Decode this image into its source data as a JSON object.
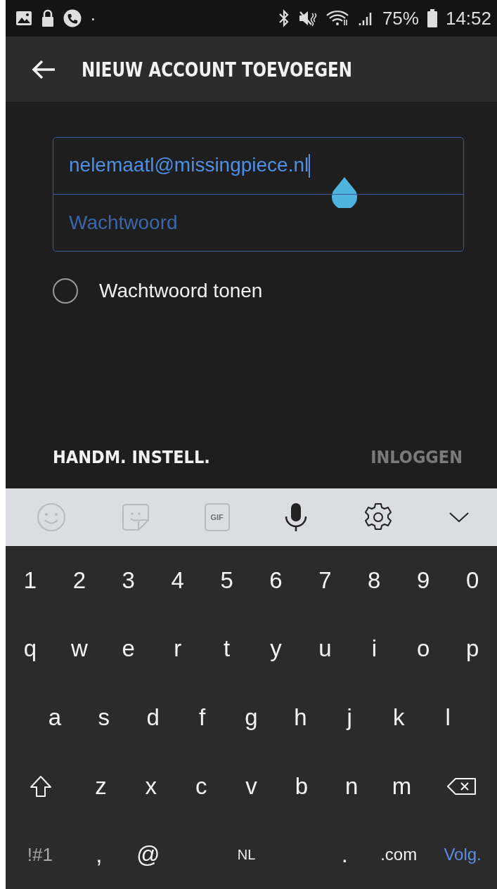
{
  "status_bar": {
    "notification_dot": "·",
    "battery": "75%",
    "time": "14:52"
  },
  "app_bar": {
    "title": "NIEUW ACCOUNT TOEVOEGEN"
  },
  "form": {
    "email": {
      "value": "nelemaatl@missingpiece.nl"
    },
    "password": {
      "placeholder": "Wachtwoord"
    },
    "show_password": {
      "label": "Wachtwoord tonen",
      "checked": false
    }
  },
  "actions": [
    {
      "label": "HANDM. INSTELL.",
      "disabled": false
    },
    {
      "label": "INLOGGEN",
      "disabled": true
    }
  ],
  "keyboard": {
    "toolbar": [
      {
        "kind": "emoji",
        "disabled": true
      },
      {
        "kind": "sticker",
        "disabled": true
      },
      {
        "kind": "gif",
        "label": "GIF",
        "disabled": true
      },
      {
        "kind": "mic",
        "disabled": false
      },
      {
        "kind": "settings",
        "disabled": false
      },
      {
        "kind": "collapse",
        "disabled": false
      }
    ],
    "rows": [
      {
        "keys": [
          {
            "kind": "char",
            "label": "1"
          },
          {
            "kind": "char",
            "label": "2"
          },
          {
            "kind": "char",
            "label": "3"
          },
          {
            "kind": "char",
            "label": "4"
          },
          {
            "kind": "char",
            "label": "5"
          },
          {
            "kind": "char",
            "label": "6"
          },
          {
            "kind": "char",
            "label": "7"
          },
          {
            "kind": "char",
            "label": "8"
          },
          {
            "kind": "char",
            "label": "9"
          },
          {
            "kind": "char",
            "label": "0"
          }
        ]
      },
      {
        "keys": [
          {
            "kind": "char",
            "label": "q"
          },
          {
            "kind": "char",
            "label": "w"
          },
          {
            "kind": "char",
            "label": "e"
          },
          {
            "kind": "char",
            "label": "r"
          },
          {
            "kind": "char",
            "label": "t"
          },
          {
            "kind": "char",
            "label": "y"
          },
          {
            "kind": "char",
            "label": "u"
          },
          {
            "kind": "char",
            "label": "i"
          },
          {
            "kind": "char",
            "label": "o"
          },
          {
            "kind": "char",
            "label": "p"
          }
        ]
      },
      {
        "keys": [
          {
            "kind": "char",
            "label": "a"
          },
          {
            "kind": "char",
            "label": "s"
          },
          {
            "kind": "char",
            "label": "d"
          },
          {
            "kind": "char",
            "label": "f"
          },
          {
            "kind": "char",
            "label": "g"
          },
          {
            "kind": "char",
            "label": "h"
          },
          {
            "kind": "char",
            "label": "j"
          },
          {
            "kind": "char",
            "label": "k"
          },
          {
            "kind": "char",
            "label": "l"
          }
        ]
      },
      {
        "keys": [
          {
            "kind": "shift"
          },
          {
            "kind": "char",
            "label": "z"
          },
          {
            "kind": "char",
            "label": "x"
          },
          {
            "kind": "char",
            "label": "c"
          },
          {
            "kind": "char",
            "label": "v"
          },
          {
            "kind": "char",
            "label": "b"
          },
          {
            "kind": "char",
            "label": "n"
          },
          {
            "kind": "char",
            "label": "m"
          },
          {
            "kind": "backspace"
          }
        ]
      },
      {
        "keys": [
          {
            "kind": "symbols",
            "label": "!#1"
          },
          {
            "kind": "char",
            "label": ","
          },
          {
            "kind": "char",
            "label": "@"
          },
          {
            "kind": "space",
            "label": "NL"
          },
          {
            "kind": "char",
            "label": "."
          },
          {
            "kind": "domain",
            "label": ".com"
          },
          {
            "kind": "action",
            "label": "Volg."
          }
        ]
      }
    ]
  }
}
